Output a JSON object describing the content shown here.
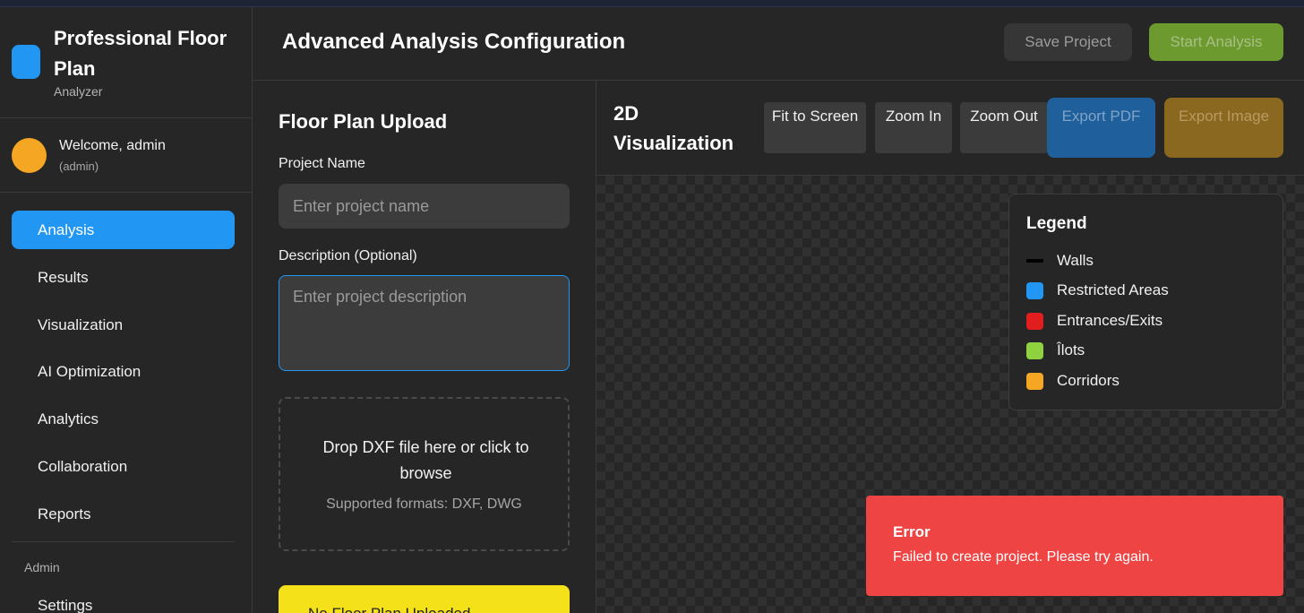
{
  "brand": {
    "title": "Professional Floor Plan",
    "subtitle": "Analyzer"
  },
  "user": {
    "welcome": "Welcome, admin",
    "role": "(admin)"
  },
  "nav": {
    "items": [
      "Analysis",
      "Results",
      "Visualization",
      "AI Optimization",
      "Analytics",
      "Collaboration",
      "Reports"
    ],
    "active": "Analysis",
    "section_label": "Admin",
    "admin_items": [
      "Settings"
    ]
  },
  "header": {
    "title": "Advanced Analysis Configuration",
    "save_label": "Save Project",
    "start_label": "Start Analysis"
  },
  "upload": {
    "title": "Floor Plan Upload",
    "project_name_label": "Project Name",
    "project_name_placeholder": "Enter project name",
    "description_label": "Description (Optional)",
    "description_placeholder": "Enter project description",
    "drop_text": "Drop DXF file here or click to browse",
    "supported": "Supported formats: DXF, DWG",
    "status": "No Floor Plan Uploaded"
  },
  "visualization": {
    "title": "2D Visualization",
    "buttons": [
      "Fit to Screen",
      "Zoom In",
      "Zoom Out",
      "Export PDF",
      "Export Image"
    ]
  },
  "legend": {
    "title": "Legend",
    "items": [
      {
        "label": "Walls",
        "color": "#000000"
      },
      {
        "label": "Restricted Areas",
        "color": "#2196f3"
      },
      {
        "label": "Entrances/Exits",
        "color": "#e11d1d"
      },
      {
        "label": "Îlots",
        "color": "#8fd13f"
      },
      {
        "label": "Corridors",
        "color": "#f5a623"
      }
    ]
  },
  "toast": {
    "title": "Error",
    "message": "Failed to create project. Please try again."
  },
  "colors": {
    "accent": "#2196f3",
    "success": "#6c9a2e",
    "error": "#ef4444",
    "warning": "#f5e11a"
  }
}
